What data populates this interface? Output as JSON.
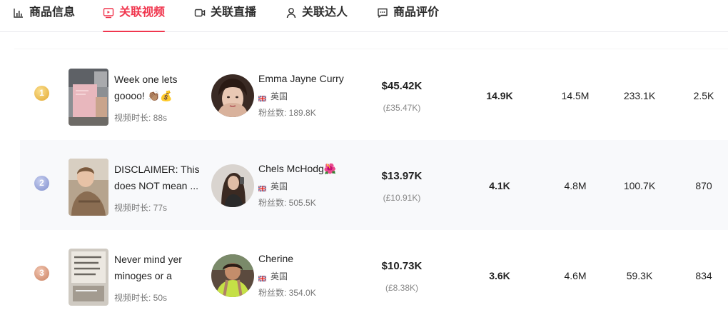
{
  "tabs": [
    {
      "label": "商品信息",
      "icon": "bar-chart-icon"
    },
    {
      "label": "关联视频",
      "icon": "video-screen-icon",
      "active": true
    },
    {
      "label": "关联直播",
      "icon": "live-camera-icon"
    },
    {
      "label": "关联达人",
      "icon": "person-icon"
    },
    {
      "label": "商品评价",
      "icon": "comment-icon"
    }
  ],
  "accent_color": "#f0364e",
  "rows": [
    {
      "rank": "1",
      "rank_color": "#e9b341",
      "video_title": "Week one lets goooo! 👏🏽💰 #savin...",
      "video_duration": "视频时长: 88s",
      "creator_name": "Emma Jayne Curry",
      "region": "英国",
      "fans": "粉丝数: 189.8K",
      "gmv_usd": "$45.42K",
      "gmv_local": "(£35.47K)",
      "sales": "14.9K",
      "views": "14.5M",
      "likes": "233.1K",
      "comments": "2.5K"
    },
    {
      "rank": "2",
      "rank_color": "#8b9ad6",
      "video_title": "DISCLAIMER: This does NOT mean ...",
      "video_duration": "视频时长: 77s",
      "creator_name": "Chels McHodg🌺",
      "region": "英国",
      "fans": "粉丝数: 505.5K",
      "gmv_usd": "$13.97K",
      "gmv_local": "(£10.91K)",
      "sales": "4.1K",
      "views": "4.8M",
      "likes": "100.7K",
      "comments": "870"
    },
    {
      "rank": "3",
      "rank_color": "#d8967a",
      "video_title": "Never mind yer minoges or a seale...",
      "video_duration": "视频时长: 50s",
      "creator_name": "Cherine",
      "region": "英国",
      "fans": "粉丝数: 354.0K",
      "gmv_usd": "$10.73K",
      "gmv_local": "(£8.38K)",
      "sales": "3.6K",
      "views": "4.6M",
      "likes": "59.3K",
      "comments": "834"
    }
  ]
}
